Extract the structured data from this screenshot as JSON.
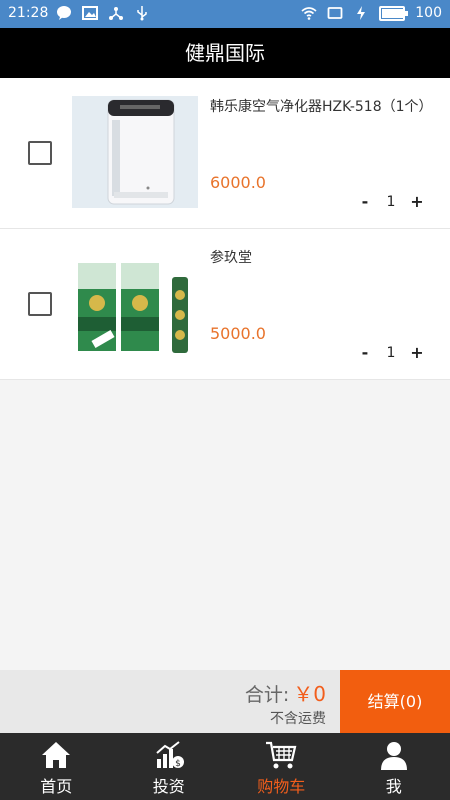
{
  "status_bar": {
    "time": "21:28",
    "battery": "100",
    "battery_fraction": 0.95
  },
  "title_bar": {
    "title": "健鼎国际"
  },
  "cart_items": [
    {
      "name": "韩乐康空气净化器HZK-518（1个）",
      "price": "6000.0",
      "quantity": "1",
      "minus": "-",
      "plus": "+"
    },
    {
      "name": "参玖堂",
      "price": "5000.0",
      "quantity": "1",
      "minus": "-",
      "plus": "+"
    }
  ],
  "summary": {
    "total_label": "合计:",
    "total_amount": "￥0",
    "shipping_note": "不含运费",
    "checkout_label": "结算(0)"
  },
  "tab_bar": {
    "tabs": [
      {
        "label": "首页",
        "icon": "home-icon"
      },
      {
        "label": "投资",
        "icon": "investment-chart-icon"
      },
      {
        "label": "购物车",
        "icon": "shopping-cart-icon",
        "active": true
      },
      {
        "label": "我",
        "icon": "user-icon"
      }
    ]
  },
  "colors": {
    "status_bar": "#4a88c8",
    "title_bar": "#000000",
    "accent": "#f25e1c",
    "price": "#e8732b",
    "tab_bar": "#2b2b2b"
  }
}
